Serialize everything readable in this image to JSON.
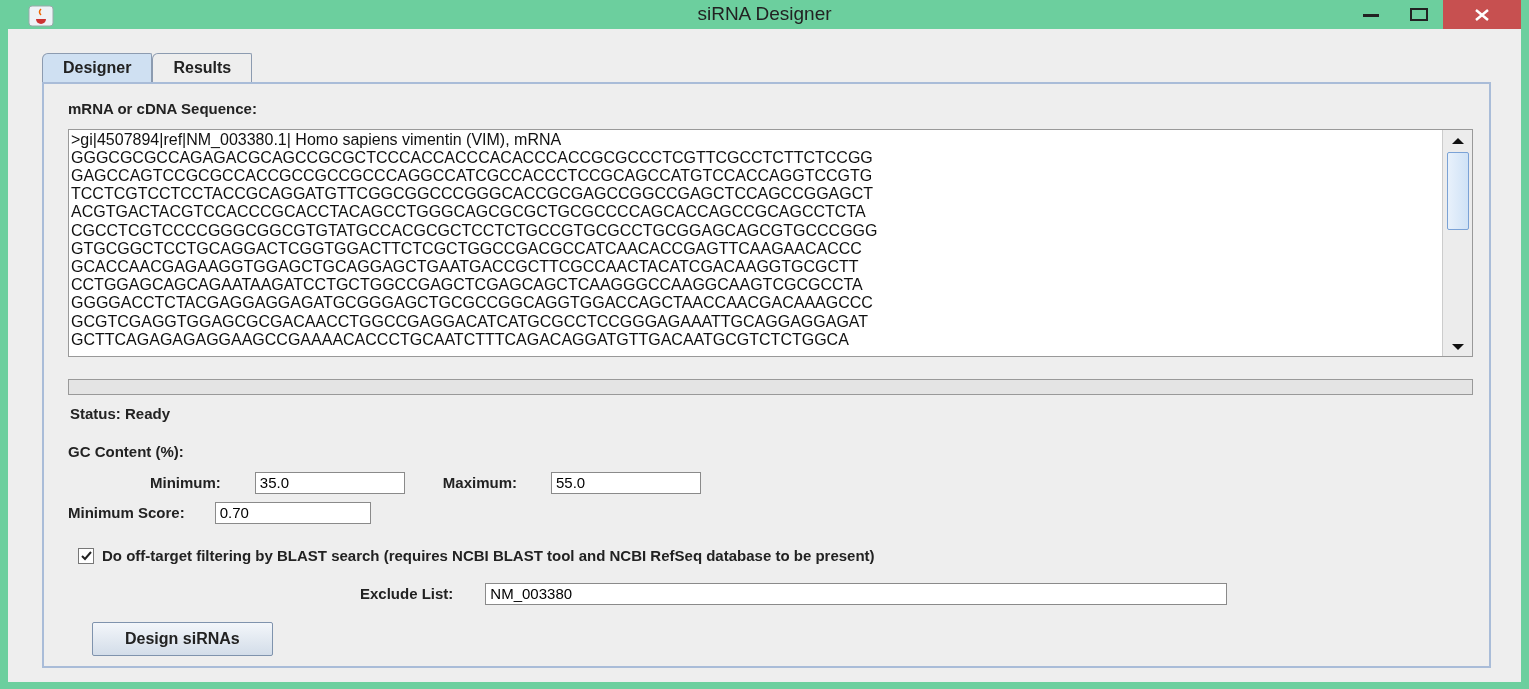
{
  "window": {
    "title": "siRNA Designer"
  },
  "tabs": [
    {
      "label": "Designer",
      "selected": true
    },
    {
      "label": "Results",
      "selected": false
    }
  ],
  "sequence": {
    "label": "mRNA or cDNA Sequence:",
    "lines": [
      ">gi|4507894|ref|NM_003380.1| Homo sapiens vimentin (VIM), mRNA",
      "GGGCGCGCCAGAGACGCAGCCGCGCTCCCACCACCCACACCCACCGCGCCCTCGTTCGCCTCTTCTCCGG",
      "GAGCCAGTCCGCGCCACCGCCGCCGCCCAGGCCATCGCCACCCTCCGCAGCCATGTCCACCAGGTCCGTG",
      "TCCTCGTCCTCCTACCGCAGGATGTTCGGCGGCCCGGGCACCGCGAGCCGGCCGAGCTCCAGCCGGAGCT",
      "ACGTGACTACGTCCACCCGCACCTACAGCCTGGGCAGCGCGCTGCGCCCCAGCACCAGCCGCAGCCTCTA",
      "CGCCTCGTCCCCGGGCGGCGTGTATGCCACGCGCTCCTCTGCCGTGCGCCTGCGGAGCAGCGTGCCCGGG",
      "GTGCGGCTCCTGCAGGACTCGGTGGACTTCTCGCTGGCCGACGCCATCAACACCGAGTTCAAGAACACCC",
      "GCACCAACGAGAAGGTGGAGCTGCAGGAGCTGAATGACCGCTTCGCCAACTACATCGACAAGGTGCGCTT",
      "CCTGGAGCAGCAGAATAAGATCCTGCTGGCCGAGCTCGAGCAGCTCAAGGGCCAAGGCAAGTCGCGCCTA",
      "GGGGACCTCTACGAGGAGGAGATGCGGGAGCTGCGCCGGCAGGTGGACCAGCTAACCAACGACAAAGCCC",
      "GCGTCGAGGTGGAGCGCGACAACCTGGCCGAGGACATCATGCGCCTCCGGGAGAAATTGCAGGAGGAGAT",
      "GCTTCAGAGAGAGGAAGCCGAAAACACCCTGCAATCTTTCAGACAGGATGTTGACAATGCGTCTCTGGCA"
    ]
  },
  "status": "Status: Ready",
  "gc": {
    "label": "GC Content (%):",
    "min_label": "Minimum:",
    "min_value": "35.0",
    "max_label": "Maximum:",
    "max_value": "55.0"
  },
  "score": {
    "label": "Minimum Score:",
    "value": "0.70"
  },
  "blast": {
    "label": "Do off-target filtering by BLAST search (requires NCBI BLAST tool and NCBI RefSeq database to be present)",
    "checked": true
  },
  "exclude": {
    "label": "Exclude List:",
    "value": "NM_003380"
  },
  "design_button": "Design siRNAs"
}
